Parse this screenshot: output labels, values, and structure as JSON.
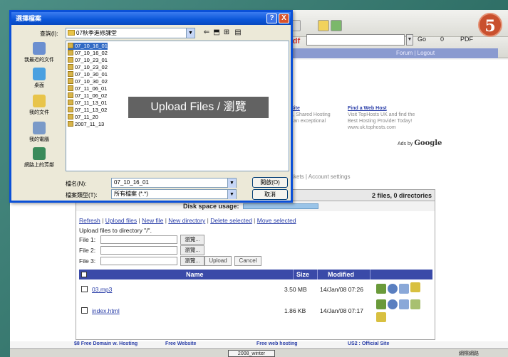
{
  "step_number": "5",
  "caption": "Upload Files / 瀏覽",
  "browser": {
    "toolbar_pdf": "pdf",
    "toolbar_go": "Go",
    "toolbar_zero": "0",
    "toolbar_pdf_btn": "PDF",
    "forum_bar": "Forum | Logout"
  },
  "ads": [
    {
      "title": "Site",
      "body": "s, Shared Hosting\nt an exceptional"
    },
    {
      "title": "Find a Web Host",
      "body": "Visit TopHosts UK and find the\nBest Hosting Provider Today!\nwww.uk.tophosts.com"
    }
  ],
  "ads_by": "Ads by",
  "ads_google": "Google",
  "page_tabs": "ckets | Account settings",
  "file_manager": {
    "summary": "2 files, 0 directories",
    "disk_label": "Disk space usage:",
    "actions": [
      "Refresh",
      "Upload files",
      "New file",
      "New directory",
      "Delete selected",
      "Move selected"
    ],
    "upload_dir": "Upload files to directory \"/\".",
    "file_labels": [
      "File 1:",
      "File 2:",
      "File 3:"
    ],
    "browse_label": "瀏覽...",
    "upload_btn": "Upload",
    "cancel_btn": "Cancel",
    "columns": {
      "name": "Name",
      "size": "Size",
      "modified": "Modified"
    },
    "rows": [
      {
        "name": "03.mp3",
        "size": "3.50 MB",
        "modified": "14/Jan/08 07:26"
      },
      {
        "name": "index.html",
        "size": "1.86 KB",
        "modified": "14/Jan/08 07:17"
      }
    ]
  },
  "bottom_links": [
    "$8 Free Domain w. Hosting",
    "Free Website",
    "Free web hosting",
    "US2 : Official Site"
  ],
  "status": {
    "box": "2008_winter",
    "right": "網際網路"
  },
  "dialog": {
    "title": "選擇檔案",
    "help": "?",
    "close": "X",
    "lookin_label": "查詢(I):",
    "lookin_value": "07秋季進修課堂",
    "places": [
      "我最近的文件",
      "桌面",
      "我的文件",
      "我的電腦",
      "網路上的芳鄰"
    ],
    "files": [
      "07_10_16_01",
      "07_10_16_02",
      "07_10_23_01",
      "07_10_23_02",
      "07_10_30_01",
      "07_10_30_02",
      "07_11_06_01",
      "07_11_06_02",
      "07_11_13_01",
      "07_11_13_02",
      "07_11_20",
      "2007_11_13"
    ],
    "filename_label": "檔名(N):",
    "filename_value": "07_10_16_01",
    "filetype_label": "檔案類型(T):",
    "filetype_value": "所有檔案 (*.*)",
    "open_btn": "開啟(O)",
    "cancel_btn": "取消"
  },
  "colors": {
    "dialog_title": "#0b56d8",
    "table_header": "#3a4aa8",
    "link": "#2a3ea8",
    "badge": "#c9502e"
  }
}
